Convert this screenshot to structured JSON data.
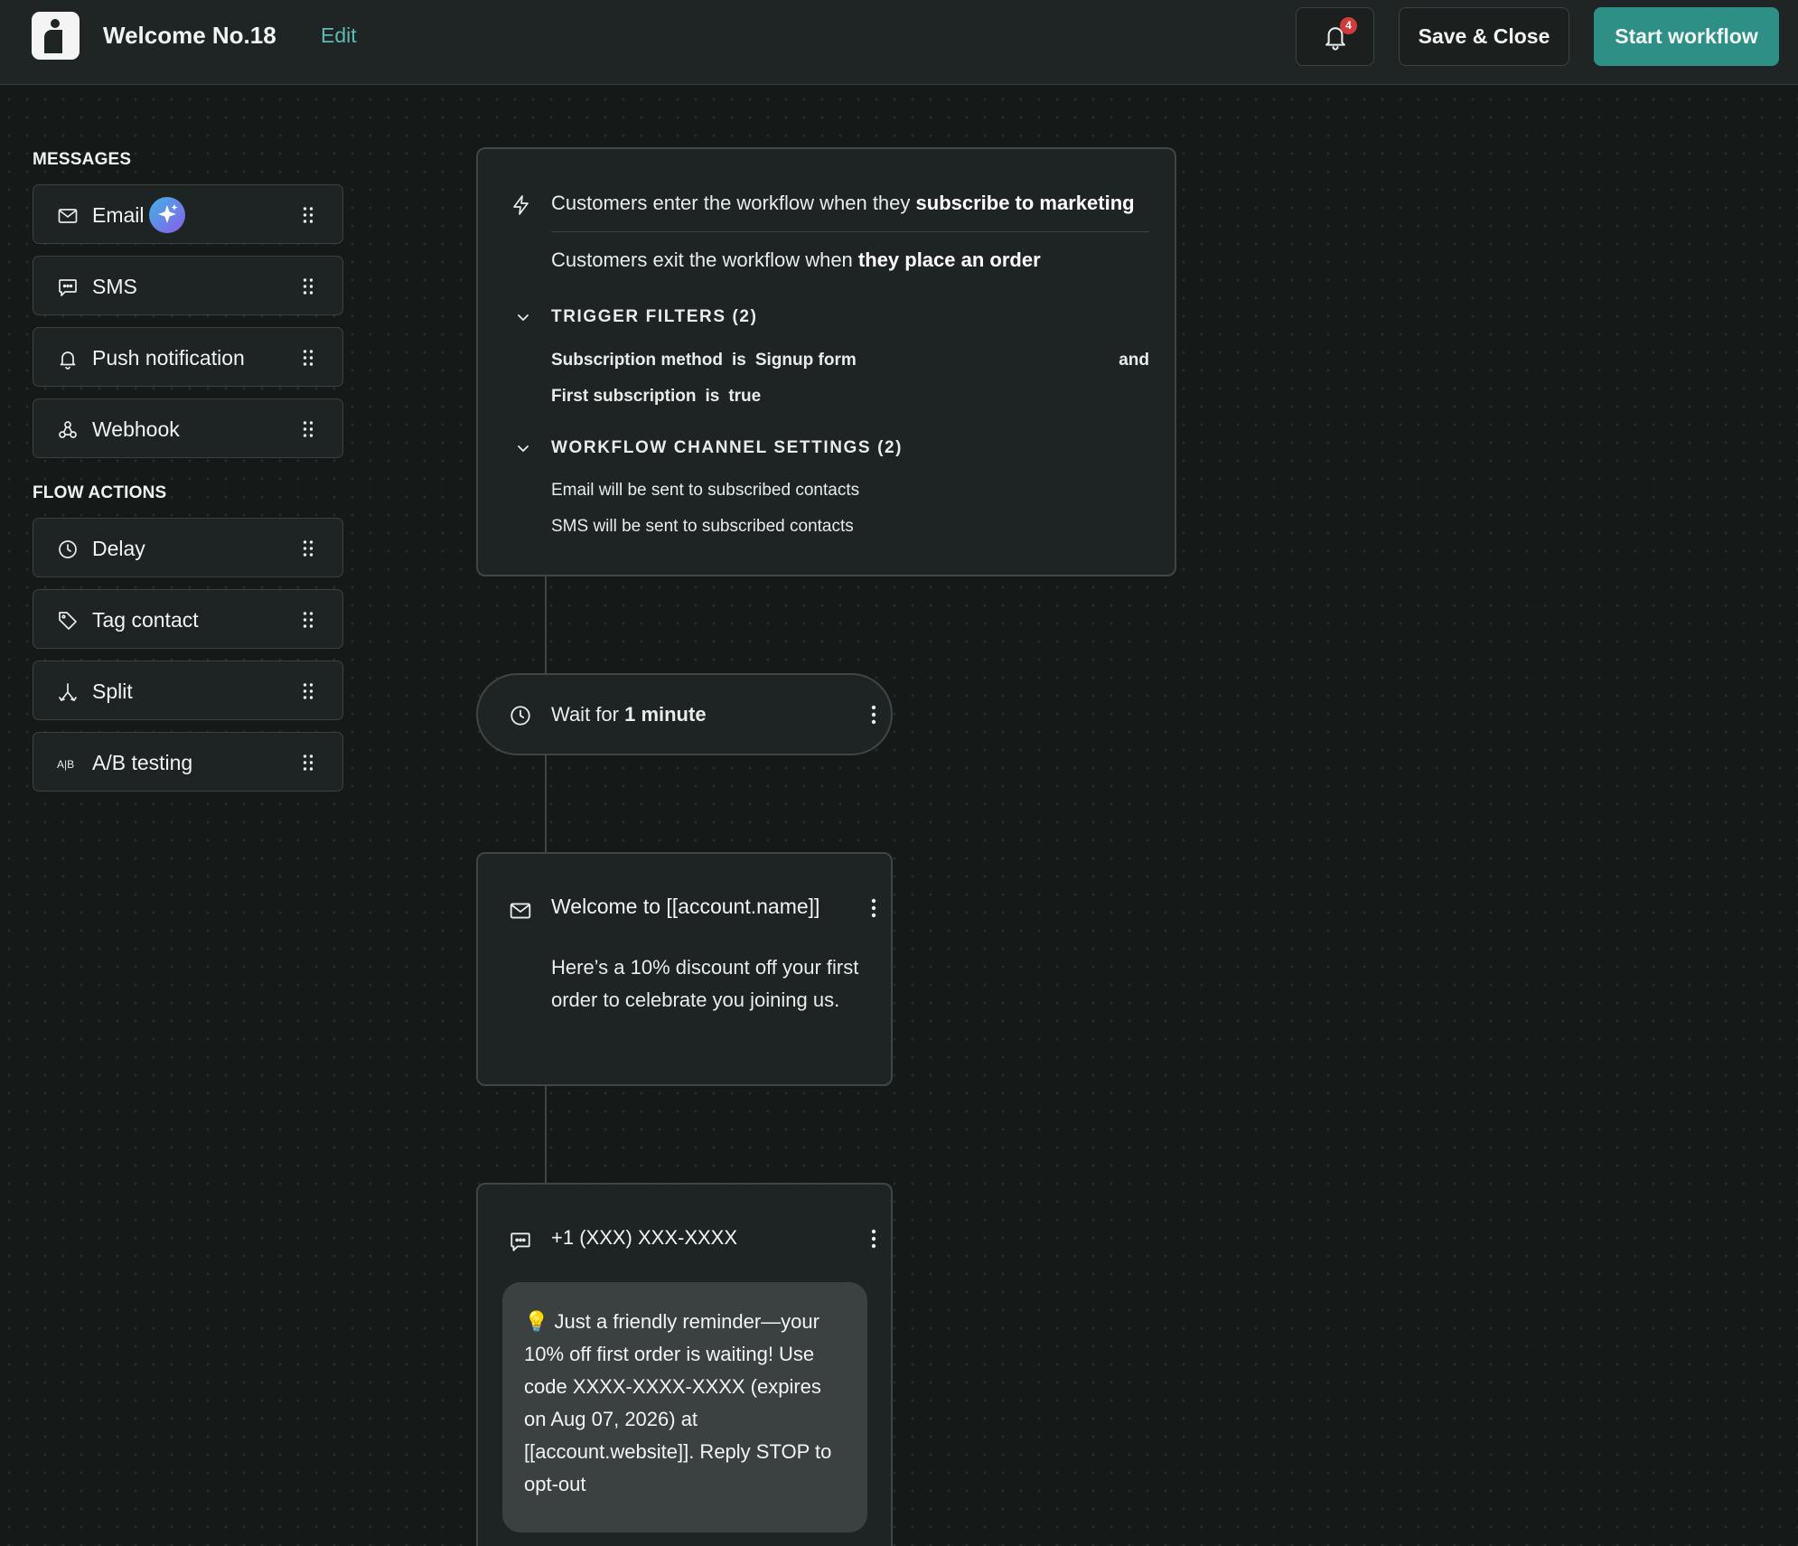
{
  "header": {
    "title": "Welcome No.18",
    "edit_label": "Edit",
    "notification_count": "4",
    "save_label": "Save & Close",
    "start_label": "Start workflow"
  },
  "sidebar": {
    "messages_heading": "MESSAGES",
    "messages": [
      {
        "label": "Email",
        "icon": "mail-icon"
      },
      {
        "label": "SMS",
        "icon": "chat-bubble-icon"
      },
      {
        "label": "Push notification",
        "icon": "bell-icon"
      },
      {
        "label": "Webhook",
        "icon": "webhook-icon"
      }
    ],
    "actions_heading": "FLOW ACTIONS",
    "actions": [
      {
        "label": "Delay",
        "icon": "clock-icon"
      },
      {
        "label": "Tag contact",
        "icon": "tag-icon"
      },
      {
        "label": "Split",
        "icon": "split-icon"
      },
      {
        "label": "A/B testing",
        "icon": "ab-icon"
      }
    ]
  },
  "trigger": {
    "enter_prefix": "Customers enter the workflow when they ",
    "enter_bold": "subscribe to marketing",
    "exit_prefix": "Customers exit the workflow when ",
    "exit_bold": "they place an order",
    "filters_heading": "TRIGGER FILTERS (2)",
    "filters": [
      {
        "field": "Subscription method",
        "op": "is",
        "value": "Signup form"
      },
      {
        "field": "First subscription",
        "op": "is",
        "value": "true"
      }
    ],
    "filters_joiner": "and",
    "channels_heading": "WORKFLOW CHANNEL SETTINGS (2)",
    "channels": [
      "Email will be sent to subscribed contacts",
      "SMS will be sent to subscribed contacts"
    ]
  },
  "wait_node": {
    "prefix": "Wait for ",
    "duration": "1 minute"
  },
  "email_node": {
    "subject": "Welcome to [[account.name]]",
    "body": "Here’s a 10% discount off your first order to celebrate you joining us."
  },
  "sms_node": {
    "number": "+1 (XXX) XXX-XXXX",
    "message": "💡 Just a friendly reminder—your 10% off first order is waiting! Use code XXXX-XXXX-XXXX (expires on Aug 07, 2026) at [[account.website]]. Reply STOP to opt-out"
  },
  "colors": {
    "accent": "#2d8f86",
    "edit_link": "#5fb8b1",
    "badge": "#d23b3b",
    "background": "#151918"
  }
}
